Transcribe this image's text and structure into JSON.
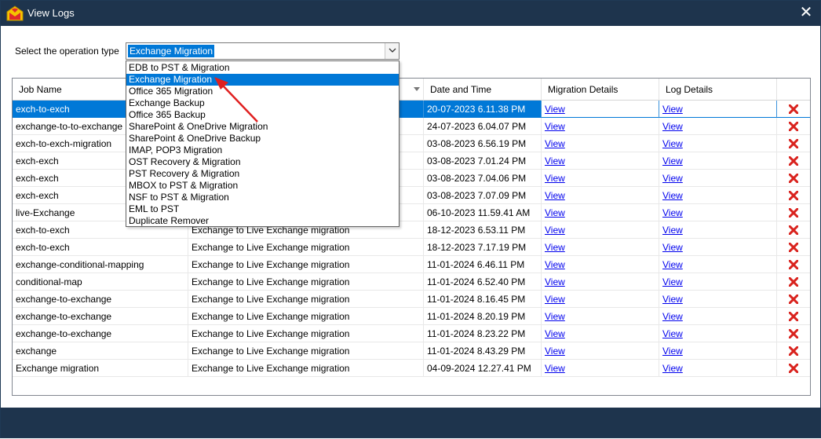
{
  "window": {
    "title": "View Logs",
    "close_glyph": "✕"
  },
  "operation": {
    "label": "Select the operation type",
    "selected": "Exchange Migration",
    "options": [
      "EDB to PST & Migration",
      "Exchange Migration",
      "Office 365 Migration",
      "Exchange Backup",
      "Office 365 Backup",
      "SharePoint & OneDrive Migration",
      "SharePoint & OneDrive Backup",
      "IMAP, POP3 Migration",
      "OST Recovery & Migration",
      "PST Recovery & Migration",
      "MBOX to PST & Migration",
      "NSF to PST & Migration",
      "EML to PST",
      "Duplicate Remover"
    ],
    "highlighted_index": 1
  },
  "table": {
    "headers": [
      "Job Name",
      "",
      "Date and Time",
      "Migration Details",
      "Log Details"
    ],
    "link_text": "View",
    "selected_row": 0,
    "rows": [
      {
        "job": "exch-to-exch",
        "type": "",
        "date": "20-07-2023 6.11.38 PM"
      },
      {
        "job": "exchange-to-to-exchange",
        "type": "",
        "date": "24-07-2023 6.04.07 PM"
      },
      {
        "job": "exch-to-exch-migration",
        "type": "",
        "date": "03-08-2023 6.56.19 PM"
      },
      {
        "job": "exch-exch",
        "type": "",
        "date": "03-08-2023 7.01.24 PM"
      },
      {
        "job": "exch-exch",
        "type": "",
        "date": "03-08-2023 7.04.06 PM"
      },
      {
        "job": "exch-exch",
        "type": "",
        "date": "03-08-2023 7.07.09 PM"
      },
      {
        "job": "live-Exchange",
        "type": "",
        "date": "06-10-2023 11.59.41 AM"
      },
      {
        "job": "exch-to-exch",
        "type": "Exchange to Live Exchange migration",
        "date": "18-12-2023 6.53.11 PM"
      },
      {
        "job": "exch-to-exch",
        "type": "Exchange to Live Exchange migration",
        "date": "18-12-2023 7.17.19 PM"
      },
      {
        "job": "exchange-conditional-mapping",
        "type": "Exchange to Live Exchange migration",
        "date": "11-01-2024 6.46.11 PM"
      },
      {
        "job": "conditional-map",
        "type": "Exchange to Live Exchange migration",
        "date": "11-01-2024 6.52.40 PM"
      },
      {
        "job": "exchange-to-exchange",
        "type": "Exchange to Live Exchange migration",
        "date": "11-01-2024 8.16.45 PM"
      },
      {
        "job": "exchange-to-exchange",
        "type": "Exchange to Live Exchange migration",
        "date": "11-01-2024 8.20.19 PM"
      },
      {
        "job": "exchange-to-exchange",
        "type": "Exchange to Live Exchange migration",
        "date": "11-01-2024 8.23.22 PM"
      },
      {
        "job": "exchange",
        "type": "Exchange to Live Exchange migration",
        "date": "11-01-2024 8.43.29 PM"
      },
      {
        "job": "Exchange migration",
        "type": "Exchange to Live Exchange migration",
        "date": "04-09-2024 12.27.41 PM"
      }
    ]
  },
  "colors": {
    "titlebar": "#1e344d",
    "accent": "#0078d7",
    "delete": "#d9231e",
    "annotation_arrow": "#e02020"
  }
}
